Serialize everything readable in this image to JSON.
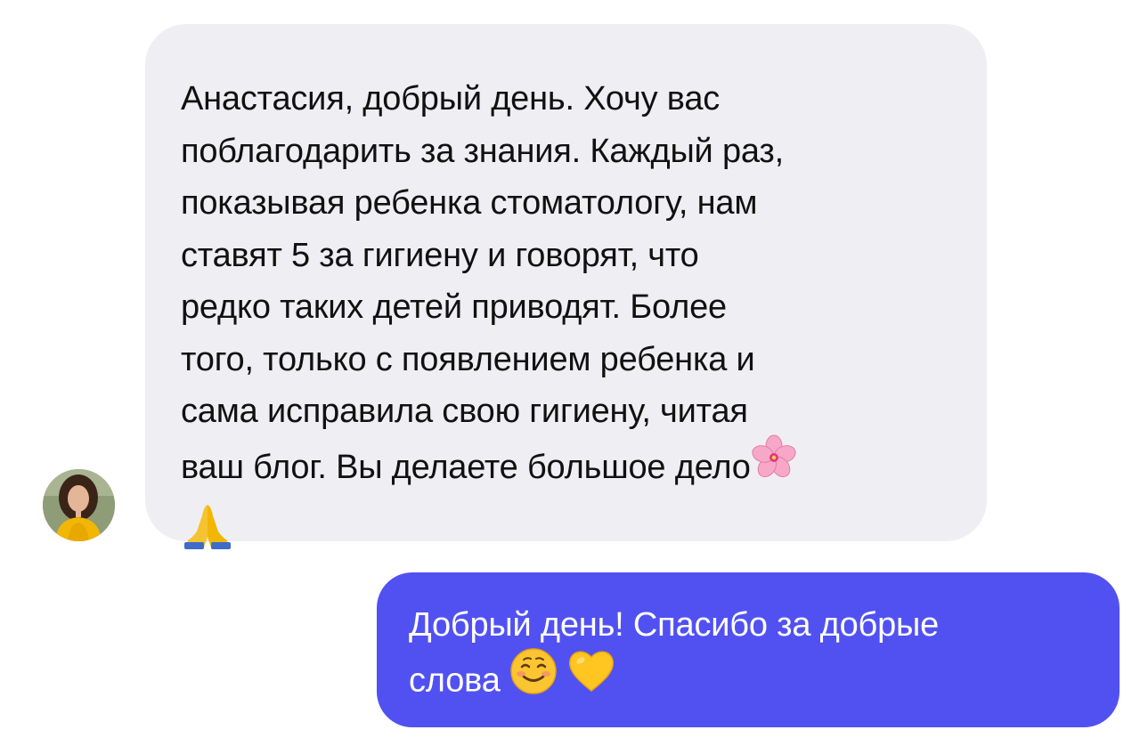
{
  "conversation": {
    "incoming": {
      "text_main": "Анастасия, добрый день. Хочу вас\nпоблагодарить за знания. Каждый раз,\nпоказывая ребенка стоматологу, нам\nставят 5 за гигиену и говорят, что\nредко таких детей приводят. Более\nтого, только с появлением ребенка и\nсама исправила свою гигиену, читая\nваш блог. Вы делаете большое дело",
      "emoji_1": "cherry-blossom-icon",
      "emoji_2": "folded-hands-icon",
      "bubble_color": "#efeff3"
    },
    "outgoing": {
      "text_main": "Добрый день! Спасибо за добрые\nслова",
      "emoji_1": "smiling-face-icon",
      "emoji_2": "yellow-heart-icon",
      "bubble_color": "#5151f2"
    }
  }
}
